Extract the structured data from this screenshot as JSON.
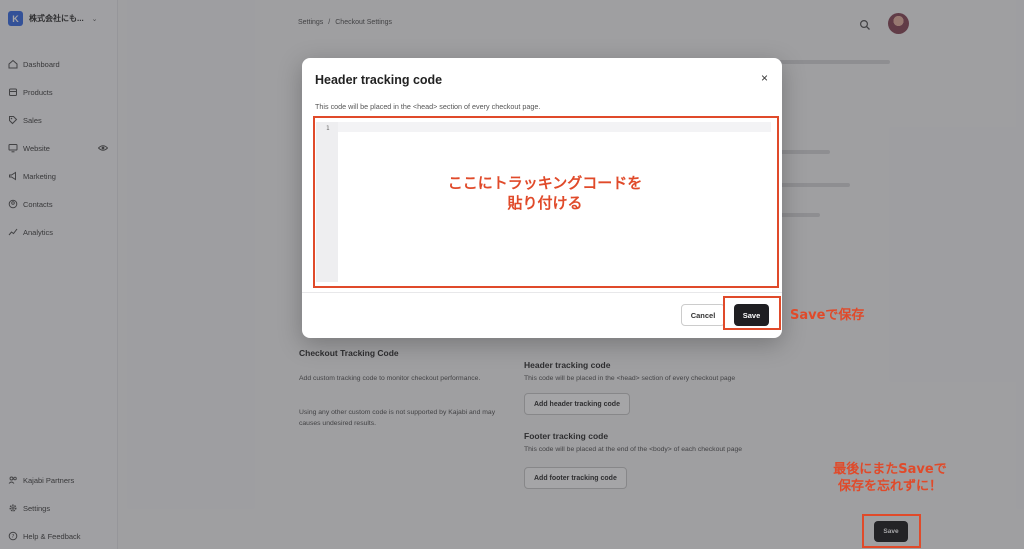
{
  "sidebar": {
    "brand_initial": "K",
    "brand_name": "株式会社にも...",
    "items": [
      {
        "label": "Dashboard",
        "icon": "dashboard-icon"
      },
      {
        "label": "Products",
        "icon": "products-icon"
      },
      {
        "label": "Sales",
        "icon": "sales-icon"
      },
      {
        "label": "Website",
        "icon": "website-icon"
      },
      {
        "label": "Marketing",
        "icon": "marketing-icon"
      },
      {
        "label": "Contacts",
        "icon": "contacts-icon"
      },
      {
        "label": "Analytics",
        "icon": "analytics-icon"
      }
    ],
    "bottom_items": [
      {
        "label": "Kajabi Partners",
        "icon": "partners-icon"
      },
      {
        "label": "Settings",
        "icon": "gear-icon"
      },
      {
        "label": "Help & Feedback",
        "icon": "help-icon"
      }
    ]
  },
  "header": {
    "breadcrumb_root": "Settings",
    "breadcrumb_sep": "/",
    "breadcrumb_current": "Checkout Settings"
  },
  "background": {
    "section_title": "Checkout Tracking Code",
    "section_desc": "Add custom tracking code to monitor checkout performance.",
    "section_warning": "Using any other custom code is not supported by Kajabi and may causes undesired results.",
    "header_title": "Header tracking code",
    "header_desc": "This code will be placed in the <head> section of every checkout page",
    "header_button": "Add header tracking code",
    "footer_title": "Footer tracking code",
    "footer_desc": "This code will be placed at the end of the <body> of each checkout page",
    "footer_button": "Add footer tracking code",
    "save_button": "Save"
  },
  "modal": {
    "title": "Header tracking code",
    "close": "×",
    "description": "This code will be placed in the <head> section of every checkout page.",
    "line_number": "1",
    "cancel_label": "Cancel",
    "save_label": "Save"
  },
  "annotations": {
    "editor_line1": "ここにトラッキングコードを",
    "editor_line2": "貼り付ける",
    "save_note": "Saveで保存",
    "final_line1": "最後にまたSaveで",
    "final_line2": "保存を忘れずに！",
    "color": "#e04a2a"
  }
}
